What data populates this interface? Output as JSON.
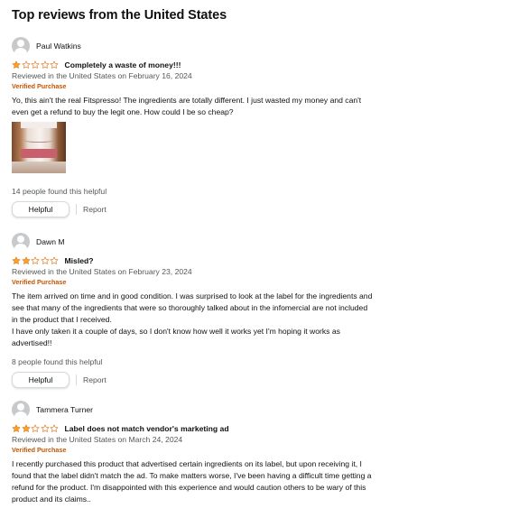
{
  "section_title": "Top reviews from the United States",
  "colors": {
    "star_fill": "#ffa41c",
    "star_outline": "#de7921",
    "verified": "#c45500",
    "secondary_text": "#565959"
  },
  "reviews": [
    {
      "profile_name": "Paul Watkins",
      "rating": 1,
      "rating_out_of": 5,
      "title": "Completely a waste of money!!!",
      "date_line": "Reviewed in the United States on February 16, 2024",
      "verified_label": "Verified Purchase",
      "body_lines": [
        "Yo, this ain't the real Fitspresso! The ingredients are totally different. I just wasted my money and can't",
        "even get a refund to buy the legit one. How could I be so cheap?"
      ],
      "helpful_count_text": "14 people found this helpful",
      "helpful_label": "Helpful",
      "report_label": "Report"
    },
    {
      "profile_name": "Dawn M",
      "rating": 2,
      "rating_out_of": 5,
      "title": "Misled?",
      "date_line": "Reviewed in the United States on February 23, 2024",
      "verified_label": "Verified Purchase",
      "body_lines": [
        "The item arrived on time and in good condition. I was surprised to look at the label for the ingredients and",
        "see that many of the ingredients that were so thoroughly talked about in the infomercial are not included",
        "in the product that I received.",
        "I have only taken it a couple of days, so I don't know how well it works yet I'm hoping it works as",
        "advertised!!"
      ],
      "helpful_count_text": "8 people found this helpful",
      "helpful_label": "Helpful",
      "report_label": "Report"
    },
    {
      "profile_name": "Tammera Turner",
      "rating": 2,
      "rating_out_of": 5,
      "title": "Label does not match vendor's marketing ad",
      "date_line": "Reviewed in the United States on March 24, 2024",
      "verified_label": "Verified Purchase",
      "body_lines": [
        "I recently purchased this product that advertised certain ingredients on its label, but upon receiving it, I",
        "found that the label didn't match the ad. To make matters worse, I've been having a difficult time getting a",
        "refund for the product. I'm disappointed with this experience and would caution others to be wary of this",
        "product and its claims.."
      ]
    }
  ]
}
